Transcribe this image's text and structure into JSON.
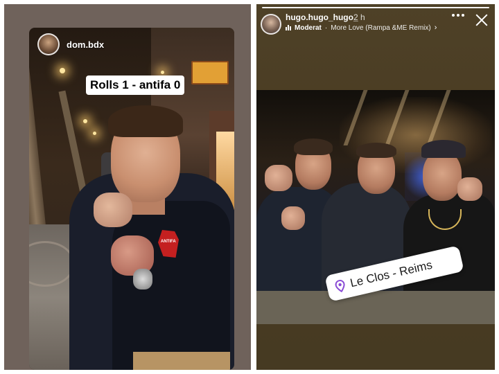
{
  "left_story": {
    "username": "dom.bdx",
    "caption": "Rolls 1 - antifa 0",
    "avatar_icon": "profile-avatar",
    "badge_text": "ANTIFA"
  },
  "right_story": {
    "username": "hugo.hugo_hugo_",
    "time_ago": "2 h",
    "music": {
      "icon": "music-bars-icon",
      "artist": "Moderat",
      "separator": "·",
      "song": "More Love (Rampa &ME Remix)",
      "chevron": "›"
    },
    "more_icon": "more-options-icon",
    "close_icon": "close-icon",
    "location": {
      "icon": "location-pin-icon",
      "label": "Le Clos - Reims",
      "pin_color": "#8a4bd6"
    }
  },
  "colors": {
    "left_frame": "#6f625b",
    "right_frame": "#4e4127",
    "caption_bg": "#ffffff"
  }
}
